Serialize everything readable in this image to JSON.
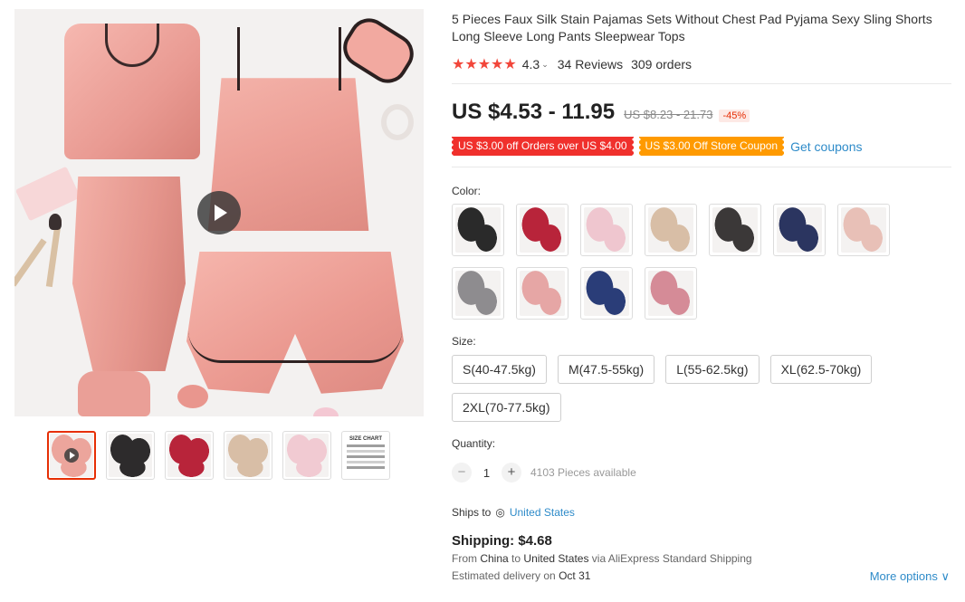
{
  "product": {
    "title": "5 Pieces Faux Silk Stain Pajamas Sets Without Chest Pad Pyjama Sexy Sling Shorts Long Sleeve Long Pants Sleepwear Tops",
    "rating": "4.3",
    "stars": "★★★★★",
    "rating_chevron": "⌄",
    "reviews": "34 Reviews",
    "orders": "309 orders"
  },
  "price": {
    "current": "US $4.53 - 11.95",
    "original": "US $8.23 - 21.73",
    "discount": "-45%"
  },
  "coupons": {
    "coupon1": "US $3.00 off Orders over US $4.00",
    "coupon2": "US $3.00 Off Store Coupon",
    "get_link": "Get coupons"
  },
  "color": {
    "label": "Color:",
    "swatches": [
      {
        "name": "black",
        "color": "#2a2a2a"
      },
      {
        "name": "red",
        "color": "#b8243a"
      },
      {
        "name": "light-pink",
        "color": "#efc6cf"
      },
      {
        "name": "champagne",
        "color": "#d8bea6"
      },
      {
        "name": "black-lace",
        "color": "#3b3838"
      },
      {
        "name": "navy-lace",
        "color": "#2b3560"
      },
      {
        "name": "pink-lace",
        "color": "#e8c0b7"
      },
      {
        "name": "grey",
        "color": "#8e8c8f"
      },
      {
        "name": "pink-print",
        "color": "#e6a6a5"
      },
      {
        "name": "navy",
        "color": "#2a3d78"
      },
      {
        "name": "rose-print",
        "color": "#d58b97"
      }
    ]
  },
  "size": {
    "label": "Size:",
    "options": [
      "S(40-47.5kg)",
      "M(47.5-55kg)",
      "L(55-62.5kg)",
      "XL(62.5-70kg)",
      "2XL(70-77.5kg)"
    ]
  },
  "quantity": {
    "label": "Quantity:",
    "minus": "−",
    "value": "1",
    "plus": "+",
    "available": "4103 Pieces available"
  },
  "shipping": {
    "ships_to_label": "Ships to",
    "pin_icon": "◎",
    "country": "United States",
    "cost": "Shipping: $4.68",
    "from_prefix": "From",
    "from_country": "China",
    "to_word": "to",
    "to_country": "United States",
    "via": "via AliExpress Standard Shipping",
    "delivery_prefix": "Estimated delivery on",
    "delivery_date": "Oct 31",
    "more_options": "More options ∨"
  },
  "thumbnails": [
    {
      "name": "pink-video",
      "color": "#eca59c",
      "selected": true
    },
    {
      "name": "black-set",
      "color": "#2d2b2c"
    },
    {
      "name": "red-set",
      "color": "#b8243a"
    },
    {
      "name": "champagne-set",
      "color": "#d8bea6"
    },
    {
      "name": "light-pink-set",
      "color": "#f1cad2"
    },
    {
      "name": "size-chart",
      "color": "#ffffff"
    }
  ],
  "size_chart_title": "SIZE CHART"
}
